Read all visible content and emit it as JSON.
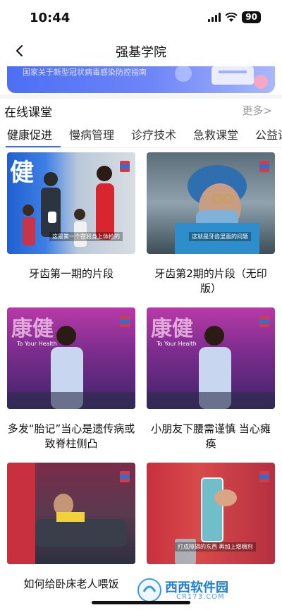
{
  "status": {
    "time": "10:44",
    "battery": "90"
  },
  "nav": {
    "title": "强基学院"
  },
  "banner": {
    "text": "国家关于新型冠状病毒感染防控指南"
  },
  "section": {
    "title": "在线课堂",
    "more": "更多>"
  },
  "tabs": [
    {
      "label": "健康促进",
      "active": true
    },
    {
      "label": "慢病管理",
      "active": false
    },
    {
      "label": "诊疗技术",
      "active": false
    },
    {
      "label": "急救课堂",
      "active": false
    },
    {
      "label": "公益讲",
      "active": false
    }
  ],
  "cards": [
    {
      "title": "牙齿第一期的片段",
      "caption": "这是第一个在我身上体检的"
    },
    {
      "title": "牙齿第2期的片段（无印版）",
      "caption": "这就是牙齿里面的问题"
    },
    {
      "title": "多发“胎记”当心是遗传病或致脊柱侧凸",
      "caption": "To Your Health"
    },
    {
      "title": "小朋友下腰需谨慎 当心瘫痪",
      "caption": "To Your Health"
    },
    {
      "title": "如何给卧床老人喂饭",
      "caption": ""
    },
    {
      "title": "",
      "caption": "打成障碍的东西 再加上增稠剂"
    }
  ],
  "watermark": {
    "brand": "西西软件园",
    "url": "CR173.COM"
  },
  "colors": {
    "accent": "#3b6df0",
    "banner": "#5a78f6",
    "muted": "#999999"
  }
}
